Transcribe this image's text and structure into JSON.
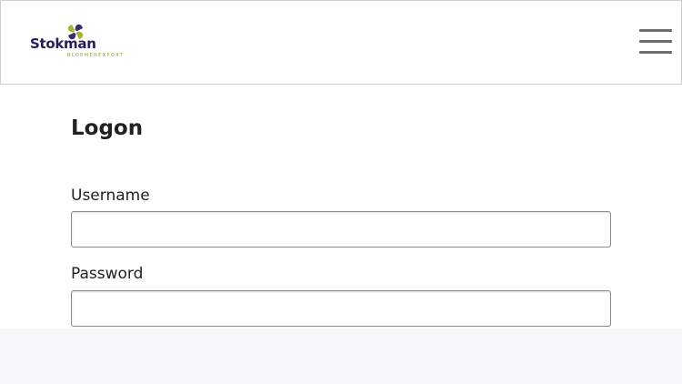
{
  "header": {
    "logo": {
      "brand": "Stokman",
      "tagline": "BLOEMENEXPORT",
      "colors": [
        "#3b2a6e",
        "#a4b62a"
      ]
    },
    "menu_icon": "hamburger-menu-icon"
  },
  "form": {
    "title": "Logon",
    "username": {
      "label": "Username",
      "value": "",
      "placeholder": ""
    },
    "password": {
      "label": "Password",
      "value": "",
      "placeholder": ""
    }
  }
}
